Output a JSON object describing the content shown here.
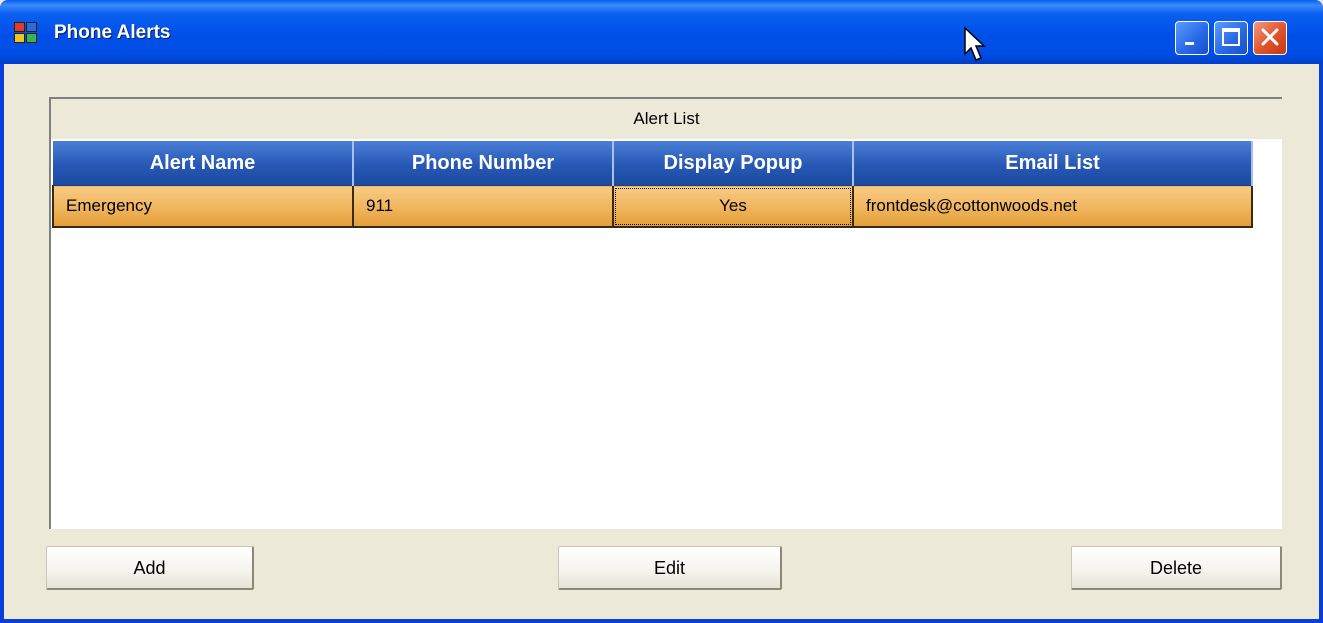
{
  "window": {
    "title": "Phone Alerts",
    "caption_buttons": [
      "minimize-icon",
      "maximize-icon",
      "close-icon"
    ]
  },
  "group": {
    "title": "Alert List"
  },
  "grid": {
    "columns": [
      "Alert Name",
      "Phone Number",
      "Display Popup",
      "Email List"
    ],
    "rows": [
      {
        "name": "Emergency",
        "phone": "911",
        "popup": "Yes",
        "email": "frontdesk@cottonwoods.net"
      }
    ]
  },
  "buttons": {
    "add": "Add",
    "edit": "Edit",
    "delete": "Delete"
  },
  "colors": {
    "titlebar": "#0054e3",
    "header": "#2a5bb8",
    "row_selected": "#f0b45c",
    "face": "#ece9d8"
  }
}
